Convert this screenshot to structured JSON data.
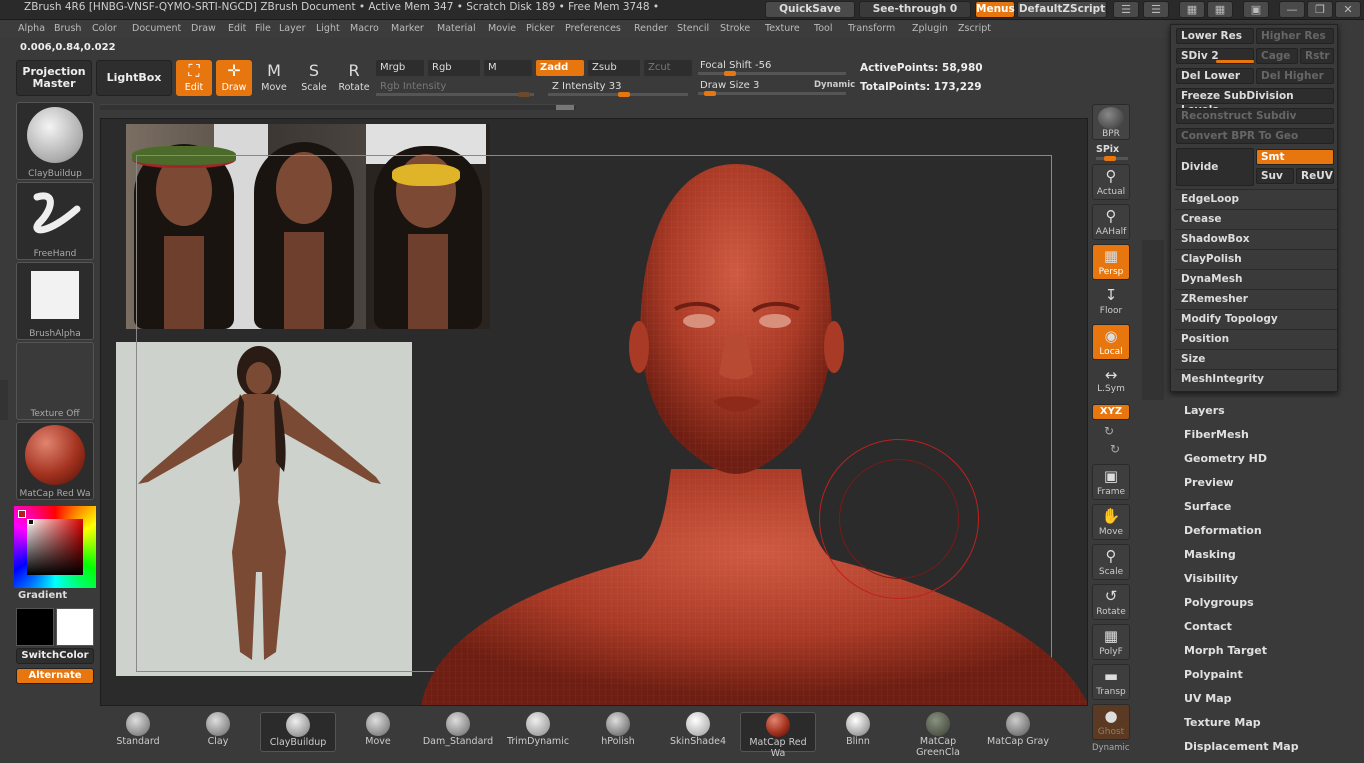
{
  "titlebar": {
    "title": "ZBrush 4R6 [HNBG-VNSF-QYMO-SRTI-NGCD]    ZBrush Document    • Active Mem 347 • Scratch Disk 189 • Free Mem 3748 •",
    "quicksave": "QuickSave",
    "seethrough": "See-through   0",
    "menus": "Menus",
    "zscript": "DefaultZScript"
  },
  "menubar": [
    "Alpha",
    "Brush",
    "Color",
    "Document",
    "Draw",
    "Edit",
    "File",
    "Layer",
    "Light",
    "Macro",
    "Marker",
    "Material",
    "Movie",
    "Picker",
    "Preferences",
    "Render",
    "Stencil",
    "Stroke",
    "Texture",
    "Tool",
    "Transform",
    "Zplugin",
    "Zscript"
  ],
  "toolbar": {
    "coords": "0.006,0.84,0.022",
    "projection_master": "Projection Master",
    "lightbox": "LightBox",
    "edit": "Edit",
    "draw": "Draw",
    "move": "Move",
    "scale": "Scale",
    "rotate": "Rotate",
    "mrgb": "Mrgb",
    "rgb": "Rgb",
    "m": "M",
    "zadd": "Zadd",
    "zsub": "Zsub",
    "zcut": "Zcut",
    "rgb_intensity": "Rgb Intensity",
    "z_intensity": "Z Intensity 33",
    "focal_shift": "Focal Shift -56",
    "draw_size": "Draw Size 3",
    "dynamic": "Dynamic",
    "active_points": "ActivePoints: 58,980",
    "total_points": "TotalPoints: 173,229"
  },
  "leftshelf": {
    "brush": "ClayBuildup",
    "stroke": "FreeHand",
    "alpha": "BrushAlpha",
    "texture": "Texture Off",
    "material": "MatCap Red Wa",
    "gradient": "Gradient",
    "switchcolor": "SwitchColor",
    "alternate": "Alternate"
  },
  "rightshelf": [
    "BPR",
    "SPix",
    "Actual",
    "AAHalf",
    "Persp",
    "Floor",
    "Local",
    "L.Sym",
    "XYZ",
    "Frame",
    "Move",
    "Scale",
    "Rotate",
    "PolyF",
    "Transp",
    "Ghost",
    "Dynamic"
  ],
  "palette": {
    "lower_res": "Lower Res",
    "higher_res": "Higher Res",
    "sdiv": "SDiv 2",
    "cage": "Cage",
    "rstr": "Rstr",
    "del_lower": "Del Lower",
    "del_higher": "Del Higher",
    "freeze": "Freeze SubDivision Levels",
    "reconstruct": "Reconstruct Subdiv",
    "convert_bpr": "Convert BPR To Geo",
    "divide": "Divide",
    "smt": "Smt",
    "suv": "Suv",
    "reuv": "ReUV",
    "rows": [
      "EdgeLoop",
      "Crease",
      "ShadowBox",
      "ClayPolish",
      "DynaMesh",
      "ZRemesher",
      "Modify Topology",
      "Position",
      "Size",
      "MeshIntegrity"
    ]
  },
  "rightlist": [
    "Layers",
    "FiberMesh",
    "Geometry HD",
    "Preview",
    "Surface",
    "Deformation",
    "Masking",
    "Visibility",
    "Polygroups",
    "Contact",
    "Morph Target",
    "Polypaint",
    "UV Map",
    "Texture Map",
    "Displacement Map"
  ],
  "bottombrushes": [
    "Standard",
    "Clay",
    "ClayBuildup",
    "Move",
    "Dam_Standard",
    "TrimDynamic",
    "hPolish",
    "SkinShade4",
    "MatCap Red Wa",
    "Blinn",
    "MatCap GreenCla",
    "MatCap Gray"
  ],
  "colors": {
    "accent": "#e8760e",
    "bg": "#3a3a3a",
    "canvas": "#2b2b2b",
    "skin": "#b4442f"
  }
}
